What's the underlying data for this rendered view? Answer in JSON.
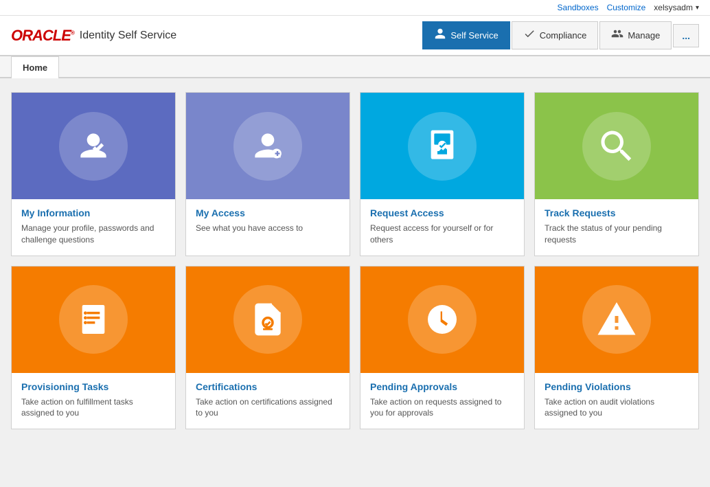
{
  "header": {
    "top": {
      "sandboxes_label": "Sandboxes",
      "customize_label": "Customize",
      "username": "xelsysadm",
      "more_icon": "▾"
    },
    "logo": "ORACLE",
    "app_title": "Identity Self Service",
    "nav": {
      "self_service_label": "Self Service",
      "compliance_label": "Compliance",
      "manage_label": "Manage",
      "more_label": "..."
    }
  },
  "tabs": [
    {
      "label": "Home",
      "active": true
    }
  ],
  "cards_row1": [
    {
      "id": "my-information",
      "title": "My Information",
      "desc": "Manage your profile, passwords and challenge questions",
      "color": "blue-dark",
      "icon": "person-edit"
    },
    {
      "id": "my-access",
      "title": "My Access",
      "desc": "See what you have access to",
      "color": "blue-medium",
      "icon": "person-key"
    },
    {
      "id": "request-access",
      "title": "Request Access",
      "desc": "Request access for yourself or for others",
      "color": "blue-bright",
      "icon": "key-card"
    },
    {
      "id": "track-requests",
      "title": "Track Requests",
      "desc": "Track the status of your pending requests",
      "color": "green",
      "icon": "search"
    }
  ],
  "cards_row2": [
    {
      "id": "provisioning-tasks",
      "title": "Provisioning Tasks",
      "desc": "Take action on fulfillment tasks assigned to you",
      "color": "orange",
      "icon": "checklist"
    },
    {
      "id": "certifications",
      "title": "Certifications",
      "desc": "Take action on certifications assigned to you",
      "color": "orange",
      "icon": "certificate"
    },
    {
      "id": "pending-approvals",
      "title": "Pending Approvals",
      "desc": "Take action on requests assigned to you for approvals",
      "color": "orange",
      "icon": "clock"
    },
    {
      "id": "pending-violations",
      "title": "Pending Violations",
      "desc": "Take action on audit violations assigned to you",
      "color": "orange",
      "icon": "warning"
    }
  ]
}
